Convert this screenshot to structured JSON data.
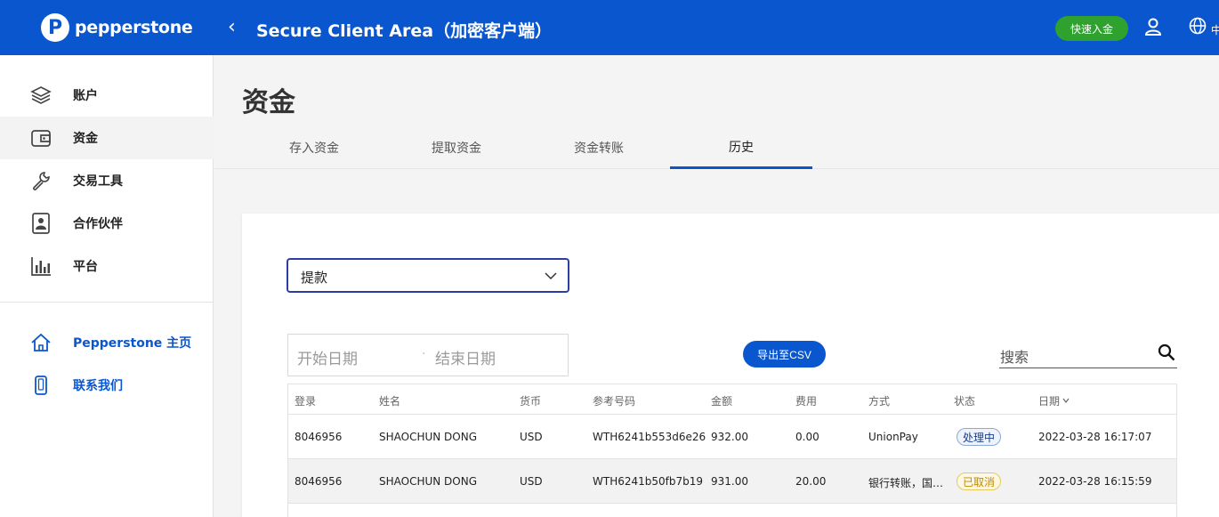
{
  "brand": {
    "name": "pepperstone",
    "logo_letter": "P",
    "color": "#0a56cf"
  },
  "header": {
    "title": "Secure Client Area（加密客户端）",
    "quick_deposit_label": "快速入金",
    "lang_label": "中"
  },
  "sidebar": {
    "items": [
      {
        "label": "账户",
        "icon": "layers-icon"
      },
      {
        "label": "资金",
        "icon": "wallet-icon",
        "active": true
      },
      {
        "label": "交易工具",
        "icon": "wrench-icon"
      },
      {
        "label": "合作伙伴",
        "icon": "id-card-icon"
      },
      {
        "label": "平台",
        "icon": "bar-chart-icon"
      }
    ],
    "links": [
      {
        "label": "Pepperstone 主页",
        "icon": "home-icon"
      },
      {
        "label": "联系我们",
        "icon": "phone-icon"
      }
    ]
  },
  "page": {
    "title": "资金"
  },
  "tabs": [
    {
      "label": "存入资金"
    },
    {
      "label": "提取资金"
    },
    {
      "label": "资金转账"
    },
    {
      "label": "历史",
      "active": true
    }
  ],
  "filters": {
    "type_select": "提款",
    "start_date_placeholder": "开始日期",
    "range_separator": "·",
    "end_date_placeholder": "结束日期",
    "export_label": "导出至CSV",
    "search_placeholder": "搜索"
  },
  "table": {
    "columns": [
      "登录",
      "姓名",
      "货币",
      "参考号码",
      "金额",
      "费用",
      "方式",
      "状态",
      "日期"
    ],
    "rows": [
      [
        "8046956",
        "SHAOCHUN DONG",
        "USD",
        "WTH6241b553d6e26",
        "932.00",
        "0.00",
        "UnionPay",
        "处理中",
        "2022-03-28 16:17:07"
      ],
      [
        "8046956",
        "SHAOCHUN DONG",
        "USD",
        "WTH6241b50fb7b19",
        "931.00",
        "20.00",
        "银行转账，国…",
        "已取消",
        "2022-03-28 16:15:59"
      ]
    ]
  },
  "status_colors": {
    "processing": "#1a3d8a",
    "cancelled": "#c08a00",
    "success_button": "#2fa12f"
  }
}
